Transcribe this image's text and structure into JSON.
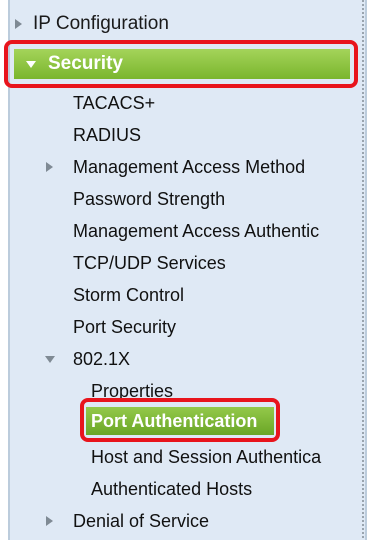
{
  "nav": {
    "ip_configuration": "IP Configuration",
    "security": {
      "label": "Security",
      "items": [
        "TACACS+",
        "RADIUS",
        "Management Access Method",
        "Password Strength",
        "Management Access Authentic",
        "TCP/UDP Services",
        "Storm Control",
        "Port Security",
        "802.1X"
      ],
      "dot1x_children": [
        "Properties",
        "Port Authentication",
        "Host and Session Authentica",
        "Authenticated Hosts"
      ],
      "denial_of_service": "Denial of Service"
    }
  },
  "colors": {
    "highlight_outline": "#e8141c",
    "selected_green": "#8bc43e",
    "panel_bg": "#dfe9f5"
  }
}
